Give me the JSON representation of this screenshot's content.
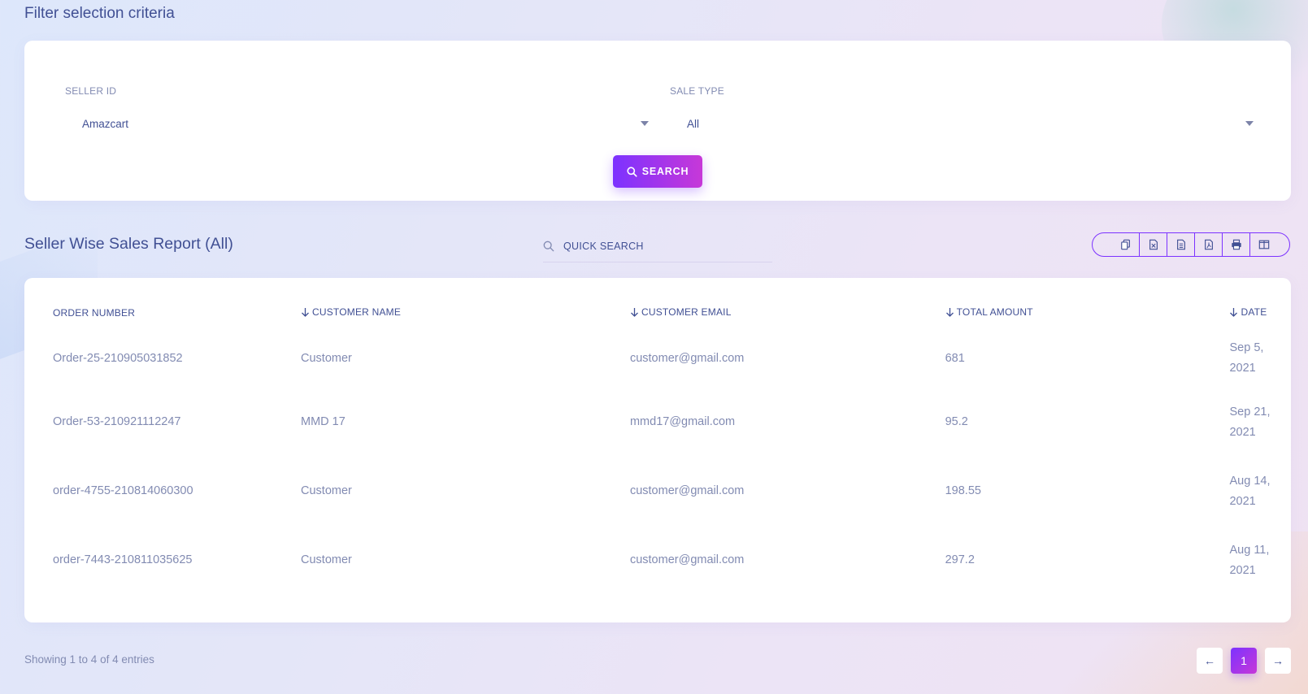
{
  "filter": {
    "title": "Filter selection criteria",
    "seller_label": "SELLER ID",
    "seller_value": "Amazcart",
    "sale_type_label": "SALE TYPE",
    "sale_type_value": "All",
    "search_label": "SEARCH"
  },
  "report": {
    "title": "Seller Wise Sales Report (All)",
    "quick_search_placeholder": "QUICK SEARCH",
    "export_icons": [
      "copy-icon",
      "excel-icon",
      "csv-icon",
      "pdf-icon",
      "print-icon",
      "columns-icon"
    ],
    "columns": [
      "ORDER NUMBER",
      "CUSTOMER NAME",
      "CUSTOMER EMAIL",
      "TOTAL AMOUNT",
      "DATE"
    ],
    "rows": [
      {
        "order": "Order-25-210905031852",
        "name": "Customer",
        "email": "customer@gmail.com",
        "amount": "681",
        "date": "Sep 5, 2021"
      },
      {
        "order": "Order-53-210921112247",
        "name": "MMD 17",
        "email": "mmd17@gmail.com",
        "amount": "95.2",
        "date": "Sep 21, 2021"
      },
      {
        "order": "order-4755-210814060300",
        "name": "Customer",
        "email": "customer@gmail.com",
        "amount": "198.55",
        "date": "Aug 14, 2021"
      },
      {
        "order": "order-7443-210811035625",
        "name": "Customer",
        "email": "customer@gmail.com",
        "amount": "297.2",
        "date": "Aug 11, 2021"
      }
    ]
  },
  "pagination": {
    "info": "Showing 1 to 4 of 4 entries",
    "prev": "←",
    "current": "1",
    "next": "→"
  },
  "colors": {
    "accent_start": "#7c32ff",
    "accent_end": "#c738d8",
    "text_primary": "#415094",
    "text_muted": "#828bb2"
  }
}
